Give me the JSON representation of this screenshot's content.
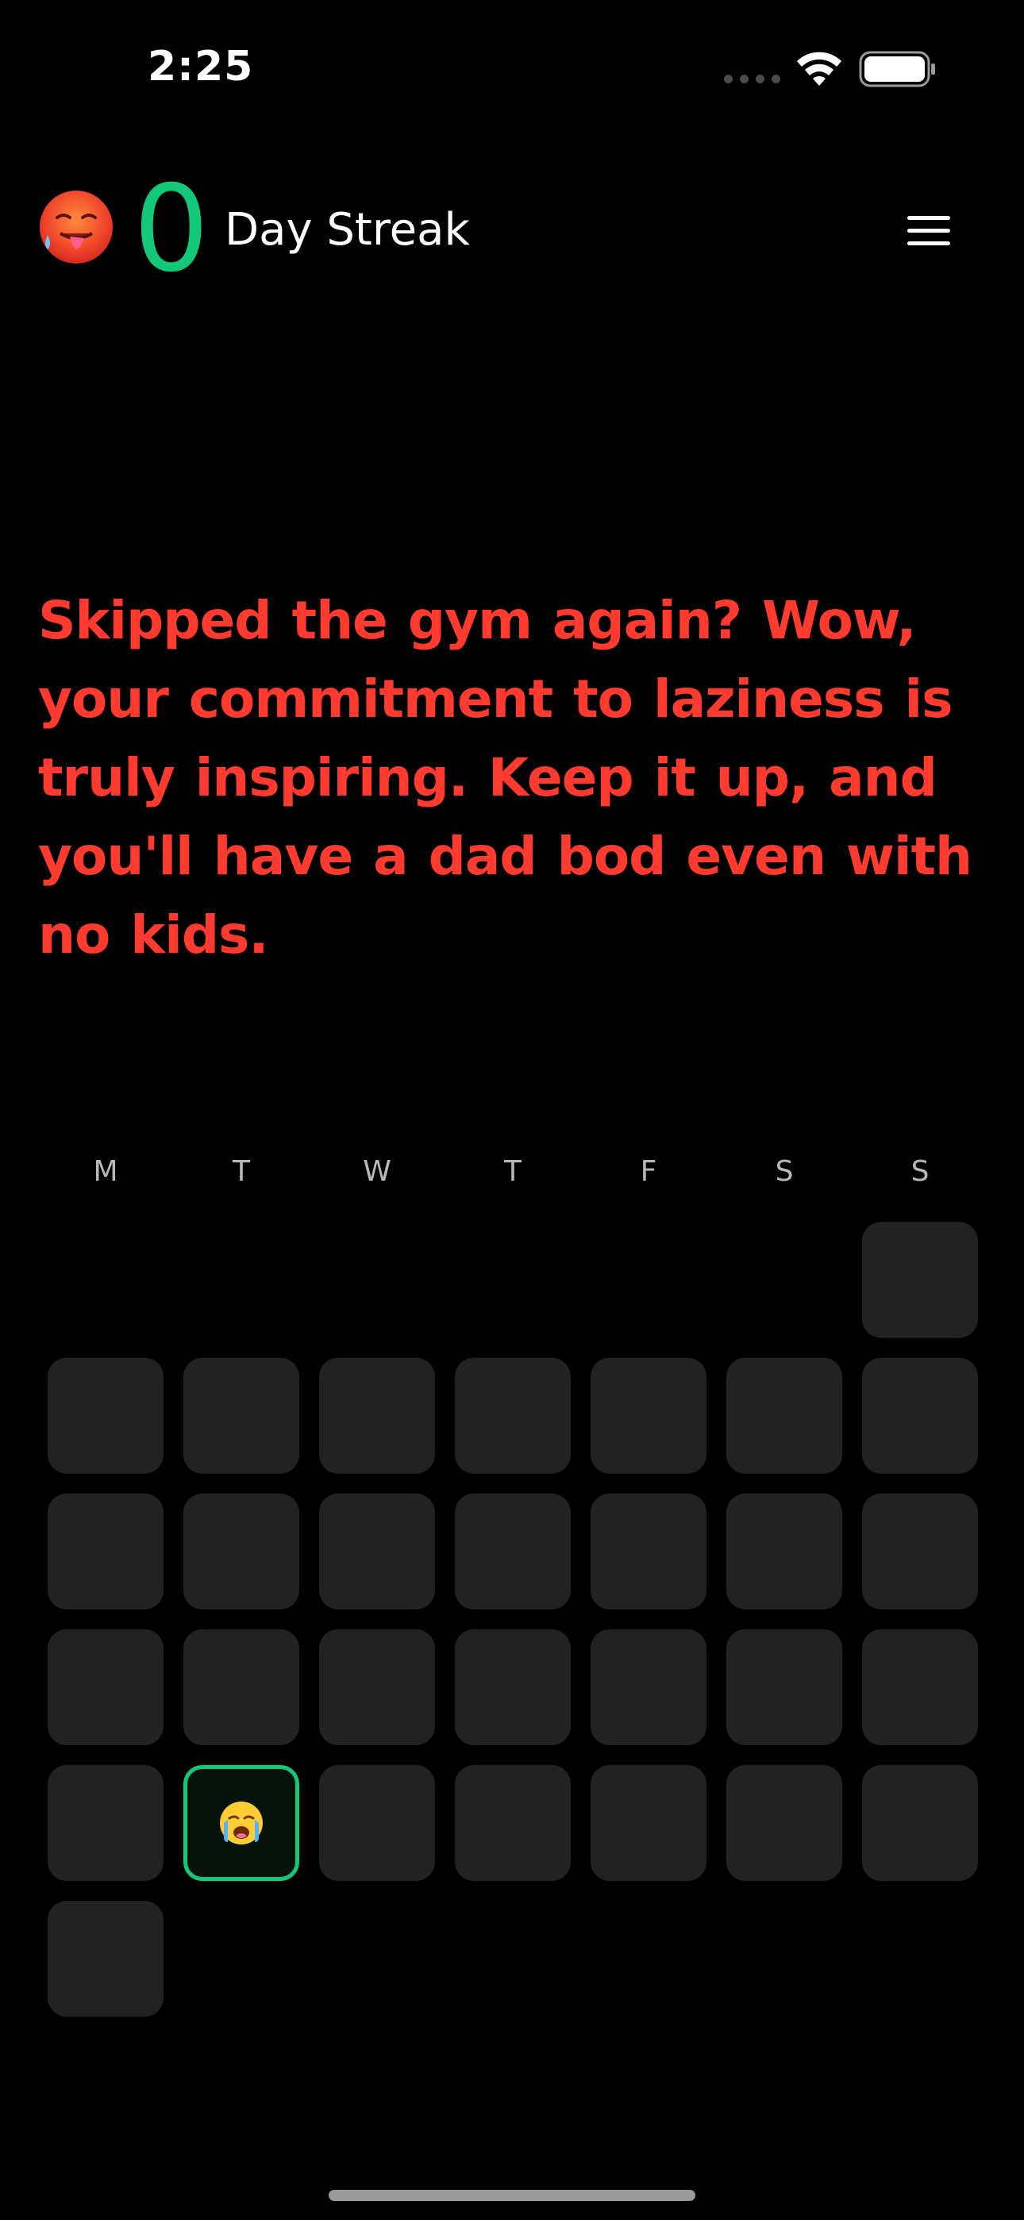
{
  "status_bar": {
    "time": "2:25"
  },
  "header": {
    "streak_emoji": "hot-face-emoji",
    "streak_count": "0",
    "streak_label": "Day Streak",
    "menu_icon": "hamburger-menu-icon"
  },
  "message": {
    "text": "Skipped the gym again? Wow, your commitment to laziness is truly inspiring. Keep it up, and you'll have a dad bod even with no kids.",
    "color": "#ff3b30"
  },
  "calendar": {
    "weekdays": [
      "M",
      "T",
      "W",
      "T",
      "F",
      "S",
      "S"
    ],
    "first_day_column": 6,
    "day_count": 30,
    "today_index": 23,
    "today_emoji": "loudly-crying-face-emoji"
  },
  "colors": {
    "background": "#000000",
    "accent": "#13c878",
    "cell": "#222222",
    "roast_text": "#ff3b30"
  }
}
